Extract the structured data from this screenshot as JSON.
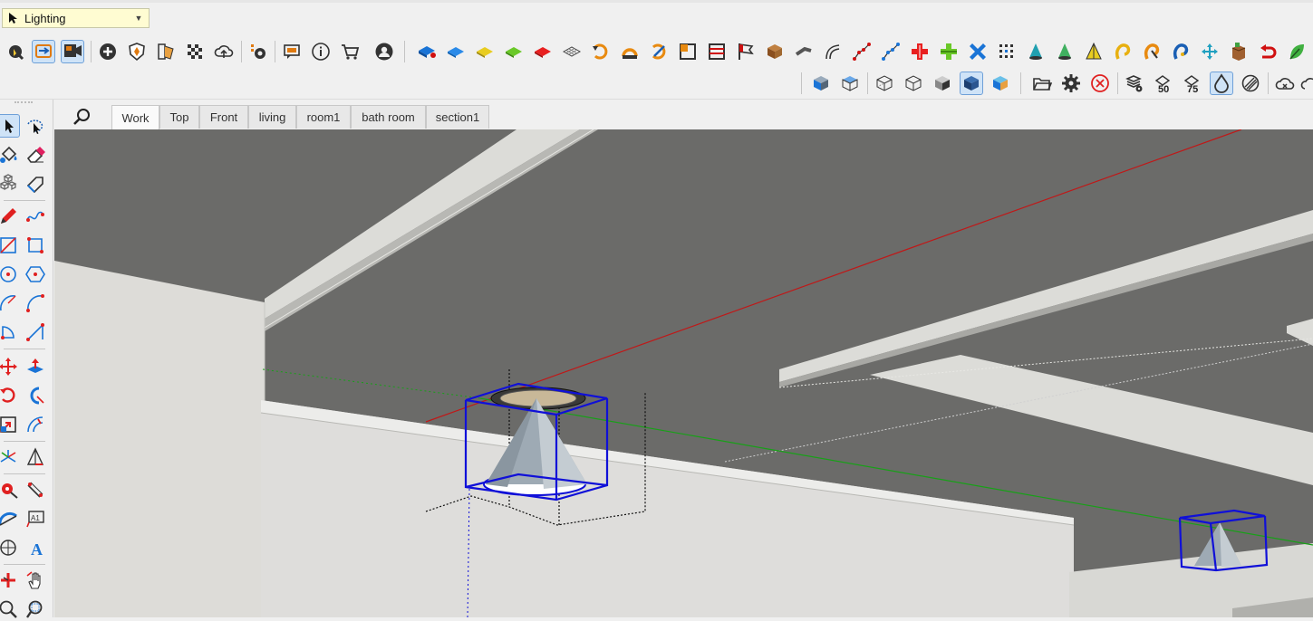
{
  "layer_dropdown": {
    "value": "Lighting"
  },
  "scene_tabs": [
    "Work",
    "Top",
    "Front",
    "living",
    "room1",
    "bath room",
    "section1"
  ],
  "toolbar_row1": [
    "select-alt-icon",
    "orbit-camera-icon",
    "position-camera-icon",
    "add-location-icon",
    "shield-icon",
    "materials-icon",
    "checker-icon",
    "cloud-upload-icon",
    "extension-settings-icon",
    "comment-icon",
    "info-icon",
    "cart-icon",
    "account-icon",
    "solid-blue-icon",
    "solid-blue2-icon",
    "solid-yellow-icon",
    "solid-green-icon",
    "solid-red-icon",
    "wireframe-icon",
    "rotate-orange-icon",
    "rotate-half-icon",
    "rotate-alt-icon",
    "frame-icon",
    "lines-icon",
    "flag-icon",
    "box-wood-icon",
    "pipe-icon",
    "curve-icon",
    "dots-red-icon",
    "dots-blue-icon",
    "plus-red-icon",
    "plus-green-icon",
    "cross-blue-icon",
    "grid-dots-icon",
    "cone-teal-icon",
    "cone-green-icon",
    "cone-yellow-icon",
    "loop-yellow-icon",
    "loop-orange-icon",
    "loop-blue-icon",
    "move-teal-icon",
    "crate-icon",
    "undo-red-icon",
    "leaf-icon"
  ],
  "toolbar_row2": [
    "iso-view-icon",
    "top-view-icon",
    "xray-icon",
    "wireframe-view-icon",
    "hidden-line-icon",
    "shaded-icon",
    "shaded-texture-icon",
    "folder-icon",
    "gear-icon",
    "close-circle-icon",
    "eye-layers-icon",
    "fifty-icon",
    "seventy-five-icon",
    "drop-icon",
    "hatch-icon",
    "cloud-x-icon",
    "cloud-icon"
  ],
  "toolbar_row2_labels": {
    "fifty": "50",
    "seventy_five": "75"
  },
  "left_toolbar": [
    "select-icon",
    "lasso-icon",
    "paint-bucket-icon",
    "eraser-icon",
    "components-icon",
    "tag-icon",
    "pencil-icon",
    "freehand-icon",
    "rectangle-icon",
    "rotated-rectangle-icon",
    "circle-icon",
    "polygon-icon",
    "arc-icon",
    "two-point-arc-icon",
    "pie-icon",
    "three-point-arc-icon",
    "move-icon",
    "push-pull-icon",
    "rotate-icon",
    "follow-me-icon",
    "scale-icon",
    "offset-icon",
    "axes-icon",
    "pyramid-icon",
    "tape-icon",
    "dimension-icon",
    "protractor-icon",
    "text-icon",
    "3d-text-icon",
    "axes-letter-icon",
    "section-plane-icon",
    "hand-icon",
    "zoom-icon",
    "zoom-window-icon"
  ],
  "left_toolbar_labels": {
    "text_tool": "A1",
    "3d_text": "A"
  },
  "colors": {
    "ceiling": "#6b6b69",
    "wall": "#dcdcd8",
    "selection": "#1010d8",
    "red_axis": "#c01818",
    "green_axis": "#18a018",
    "dropdown_bg": "#fffcd2"
  }
}
